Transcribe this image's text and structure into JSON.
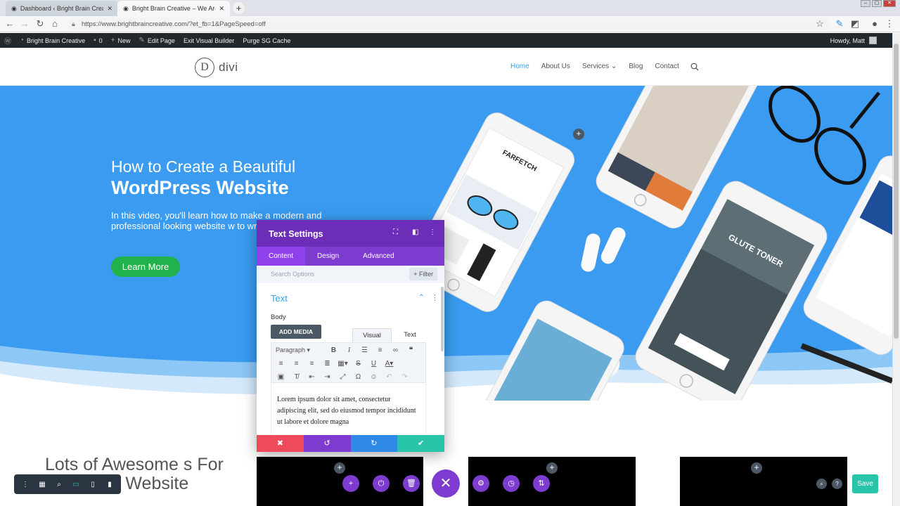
{
  "browser": {
    "tabs": [
      {
        "title": "Dashboard ‹ Bright Brain Creative"
      },
      {
        "title": "Bright Brain Creative – We Are Br"
      }
    ],
    "url": "https://www.brightbraincreative.com/?et_fb=1&PageSpeed=off"
  },
  "adminbar": {
    "site": "Bright Brain Creative",
    "comments": "0",
    "new": "New",
    "edit": "Edit Page",
    "exit": "Exit Visual Builder",
    "purge": "Purge SG Cache",
    "howdy": "Howdy, Matt"
  },
  "site": {
    "logo": "divi",
    "logo_letter": "D",
    "menu": [
      "Home",
      "About Us",
      "Services",
      "Blog",
      "Contact"
    ]
  },
  "hero": {
    "title_line1": "How to Create a Beautiful",
    "title_line2": "WordPress Website",
    "paragraph": "In this video, you'll learn how to make a modern and professional looking website w to write any code.",
    "button": "Learn More",
    "phone_brand": "FARFETCH",
    "phone_banner": "GLUTE TONER"
  },
  "section2": {
    "heading": "Lots of Awesome s For Your New Website"
  },
  "modal": {
    "title": "Text Settings",
    "tabs": [
      "Content",
      "Design",
      "Advanced"
    ],
    "search_placeholder": "Search Options",
    "filter": "+ Filter",
    "group": "Text",
    "body_label": "Body",
    "add_media": "ADD MEDIA",
    "visual_tab": "Visual",
    "text_tab": "Text",
    "paragraph_select": "Paragraph",
    "content": "Lorem ipsum dolor sit amet, consectetur adipiscing elit, sed do eiusmod tempor incididunt ut labore et dolore magna"
  },
  "builder": {
    "save": "Save"
  },
  "colors": {
    "hero_blue": "#3a9bf0",
    "divi_purple": "#7e3bd0",
    "modal_header": "#6c2eb9",
    "learn_green": "#21b24b",
    "save_teal": "#29c4a9",
    "cancel_red": "#ef4a5c",
    "redo_blue": "#2e8ae6",
    "link_blue": "#2ea3f2"
  }
}
